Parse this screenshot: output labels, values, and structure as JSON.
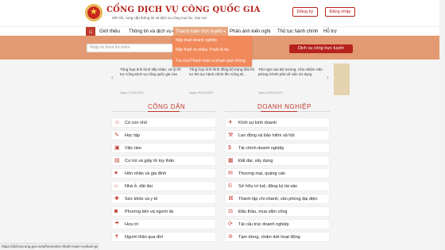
{
  "header": {
    "title": "CỔNG DỊCH VỤ CÔNG QUỐC GIA",
    "subtitle": "Kết nối, cung cấp thông tin và dịch vụ công mọi lúc, mọi nơi",
    "register": "Đăng ký",
    "login": "Đăng nhập"
  },
  "nav": {
    "home_icon": "⌂",
    "items": [
      "Giới thiệu",
      "Thông tin và dịch vụ",
      "Thanh toán trực tuyến",
      "Phản ánh kiến nghị",
      "Thủ tục hành chính",
      "Hỗ trợ"
    ]
  },
  "search": {
    "placeholder": "Nhập từ khoá tìm kiếm",
    "button_icon": "search-icon"
  },
  "banner_button": "Dịch vụ công trực tuyến",
  "dropdown": {
    "items": [
      "Nộp thuế doanh nghiệp",
      "Nộp thuế và nhiều Thuế/ lệ ba",
      "Tra cứu/Thanh toán vi phạm giao thông"
    ]
  },
  "news": {
    "items": [
      {
        "title": "Tổng hợp tình hình tiếp nhận, xử lý hỗ trợ Cổng Dịch vụ công quốc gia của Bộ...",
        "date": "Ngày 13/04/2020"
      },
      {
        "title": "Tổng hợp tình hình đồng bộ trạng thái hồ sơ thủ tục hành chính lên Cổng Dị...",
        "date": "Ngày 09/04/2020"
      },
      {
        "title": "Thứ ngỏ của Bộ trưởng, Chủ nhiệm Văn phòng Chính phủ về việc sử dụng Cổng...",
        "date": "Ngày 04/04/2020"
      }
    ]
  },
  "citizen": {
    "heading": "CÔNG DÂN",
    "items": [
      "Có con nhỏ",
      "Học tập",
      "Việc làm",
      "Cư trú và giấy tờ tùy thân",
      "Hôn nhân và gia đình",
      "Nhà ở, đất đai",
      "Sức khỏe và y tế",
      "Phương tiện và người lái",
      "Hưu trí",
      "Người thân qua đời"
    ]
  },
  "business": {
    "heading": "DOANH NGHIỆP",
    "items": [
      "Khởi sự kinh doanh",
      "Lao động và bảo hiểm xã hội",
      "Tài chính doanh nghiệp",
      "Đất đai, xây dựng",
      "Thương mại, quảng cáo",
      "Sở hữu trí tuệ, đăng ký tài sản",
      "Thành lập chi nhánh, văn phòng đại diện",
      "Đấu thầu, mua sắm công",
      "Tái cấu trúc doanh nghiệp",
      "Tạm dừng, chấm dứt hoạt động"
    ]
  },
  "status_bar": "https://dichvucong.gov.vn/p/home/dvc-thanh-toan-vi-pham-giao-thong.html"
}
